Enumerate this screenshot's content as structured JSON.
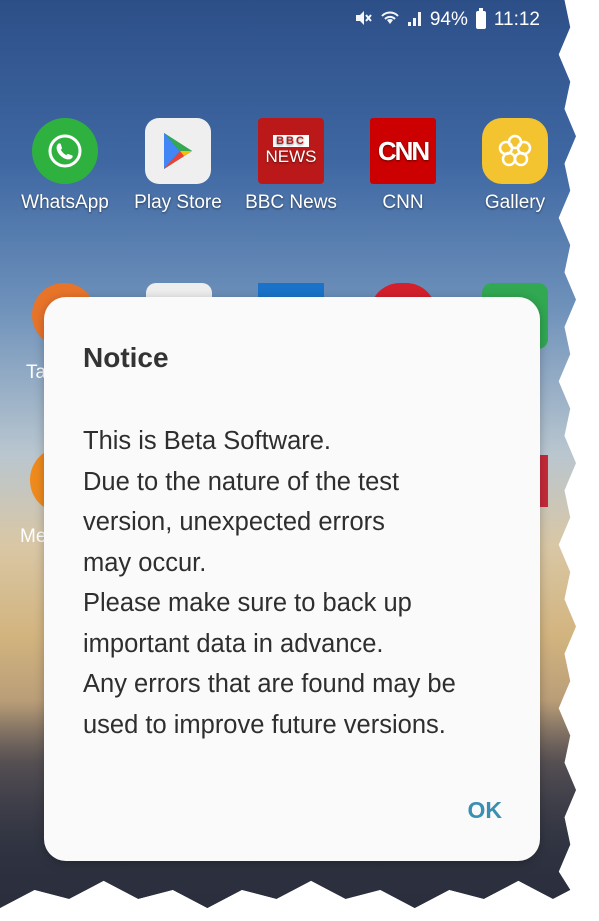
{
  "status_bar": {
    "mute_icon": "mute-icon",
    "wifi_icon": "wifi-icon",
    "signal_icon": "signal-icon",
    "battery": "94%",
    "time": "11:12"
  },
  "apps": [
    {
      "label": "WhatsApp",
      "icon": "whatsapp-icon"
    },
    {
      "label": "Play Store",
      "icon": "play-store-icon"
    },
    {
      "label": "BBC News",
      "icon": "bbc-news-icon",
      "logo_top": "BBC",
      "logo_bottom": "NEWS"
    },
    {
      "label": "CNN",
      "icon": "cnn-icon",
      "logo_text": "CNN"
    },
    {
      "label": "Gallery",
      "icon": "gallery-icon"
    }
  ],
  "partial_labels": [
    "Ta",
    "Me"
  ],
  "dialog": {
    "title": "Notice",
    "lines": [
      "This is Beta Software.",
      "Due to the nature of the test",
      "version, unexpected errors",
      "may occur.",
      "Please make sure to back up",
      "important data in advance.",
      "Any errors that are found may be",
      "used to improve future versions."
    ],
    "ok_label": "OK",
    "ok_color": "#3b8fb3"
  }
}
